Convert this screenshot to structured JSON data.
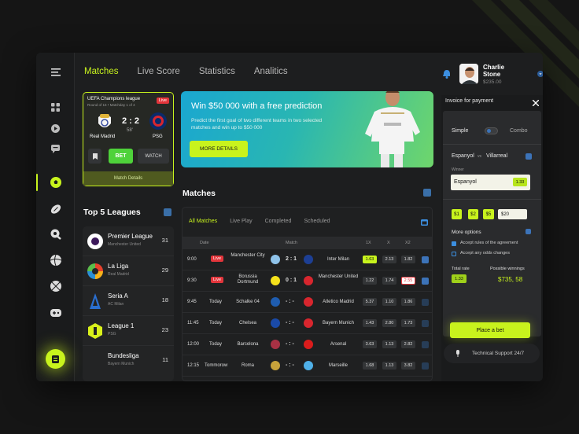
{
  "header": {
    "tabs": [
      "Matches",
      "Live Score",
      "Statistics",
      "Analitics"
    ],
    "active_tab": "Matches",
    "user": {
      "name": "Charlie Stone",
      "balance": "$235.00"
    }
  },
  "colors": {
    "accent": "#c8f31d",
    "live": "#e2353b",
    "promo_start": "#1aa7d1",
    "promo_end": "#6fd66b"
  },
  "sidebar": {
    "icons": [
      "menu-icon",
      "dashboard-icon",
      "play-icon",
      "chat-icon",
      "soccer-icon",
      "football-icon",
      "hockey-icon",
      "volleyball-icon",
      "basketball-icon",
      "gamepad-icon",
      "bet-slip-icon"
    ]
  },
  "live_card": {
    "league": "UEFA Champions league",
    "round": "Round of 16 • Matchday 1 of 4",
    "live": "Live",
    "home": "Real Madrid",
    "away": "PSG",
    "score": "2 : 2",
    "minute": "58'",
    "bet": "BET",
    "watch": "WATCH",
    "details": "Match Details"
  },
  "promo": {
    "title": "Win $50 000 with a free prediction",
    "subtitle": "Predict the first goal of two different teams in two selected matches and win up to $50 000",
    "button": "MORE DETAILS"
  },
  "leagues": {
    "title": "Top 5 Leagues",
    "items": [
      {
        "name": "Premier League",
        "sub": "Manchester United",
        "count": "31"
      },
      {
        "name": "La Liga",
        "sub": "Real Madrid",
        "count": "29"
      },
      {
        "name": "Seria A",
        "sub": "AC Milan",
        "count": "18"
      },
      {
        "name": "League 1",
        "sub": "PSG",
        "count": "23"
      },
      {
        "name": "Bundesliga",
        "sub": "Bayern Munich",
        "count": "11"
      }
    ]
  },
  "matches": {
    "title": "Matches",
    "tabs": [
      "All Matches",
      "Live Play",
      "Completed",
      "Scheduled"
    ],
    "columns": {
      "date": "Date",
      "match": "Match",
      "o1": "1X",
      "o2": "X",
      "o3": "X2"
    },
    "rows": [
      {
        "time": "9:00",
        "day": "Live",
        "home": "Manchester City",
        "score": "2 : 1",
        "away": "Inter Milan",
        "o1": "1.63",
        "o2": "2.13",
        "o3": "1.82"
      },
      {
        "time": "9:30",
        "day": "Live",
        "home": "Borussia Dortmund",
        "score": "0 : 1",
        "away": "Manchester United",
        "o1": "1.22",
        "o2": "1.74",
        "o3": "2.55"
      },
      {
        "time": "9:45",
        "day": "Today",
        "home": "Schalke 04",
        "score": "- : -",
        "away": "Atletico Madrid",
        "o1": "5.37",
        "o2": "1.10",
        "o3": "1.86"
      },
      {
        "time": "11:45",
        "day": "Today",
        "home": "Chelsea",
        "score": "- : -",
        "away": "Bayern Munich",
        "o1": "1.43",
        "o2": "2.80",
        "o3": "1.73"
      },
      {
        "time": "12:00",
        "day": "Today",
        "home": "Barcelona",
        "score": "- : -",
        "away": "Arsenal",
        "o1": "3.63",
        "o2": "1.13",
        "o3": "2.82"
      },
      {
        "time": "12:15",
        "day": "Tommorow",
        "home": "Roma",
        "score": "- : -",
        "away": "Marseille",
        "o1": "1.68",
        "o2": "1.13",
        "o3": "3.82"
      }
    ]
  },
  "invoice": {
    "title": "Invoice for payment",
    "simple": "Simple",
    "combo": "Combo",
    "home": "Espanyol",
    "vs": "vs",
    "away": "Villarreal",
    "winner_label": "Winner",
    "winner": "Espanyol",
    "winner_odd": "1.33",
    "amounts": [
      "$1",
      "$2",
      "$5"
    ],
    "amount_value": "$20",
    "more_options": "More options",
    "opt1": "Accept rules of the agreement",
    "opt2": "Accept any odds changes",
    "total_label": "Total rate",
    "total": "1.33",
    "win_label": "Possible winnings",
    "win": "$735, 58",
    "place": "Place a bet",
    "support": "Technical Support 24/7"
  }
}
